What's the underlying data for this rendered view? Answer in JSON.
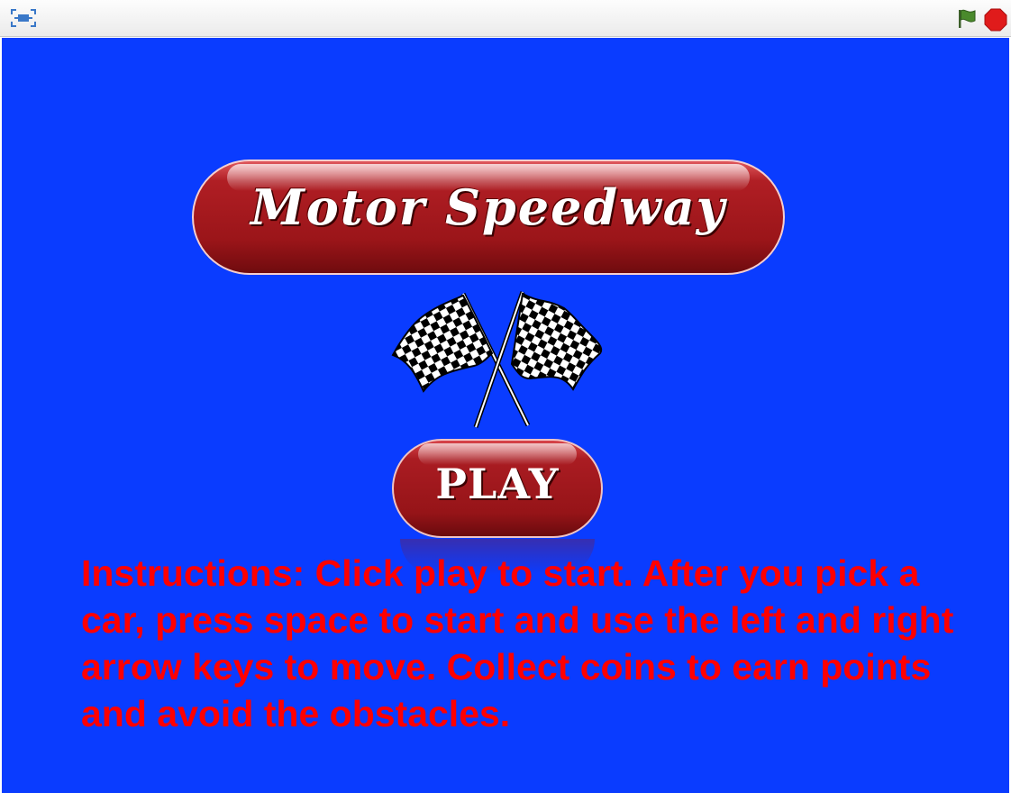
{
  "toolbar": {
    "fullscreen_icon": "fullscreen-icon",
    "flag_icon": "green-flag-icon",
    "stop_icon": "stop-icon",
    "flag_color": "#4a8a2c",
    "stop_color": "#e01b1b"
  },
  "stage": {
    "background_color": "#0a3cff",
    "title": "Motor Speedway",
    "flags_icon": "checkered-flags-icon",
    "play_label": "PLAY",
    "instructions": "Instructions: Click play to start. After you pick a car, press space to start and use the left and right arrow keys to move. Collect coins to earn points and avoid the obstacles.",
    "instructions_color": "#ff0000"
  }
}
